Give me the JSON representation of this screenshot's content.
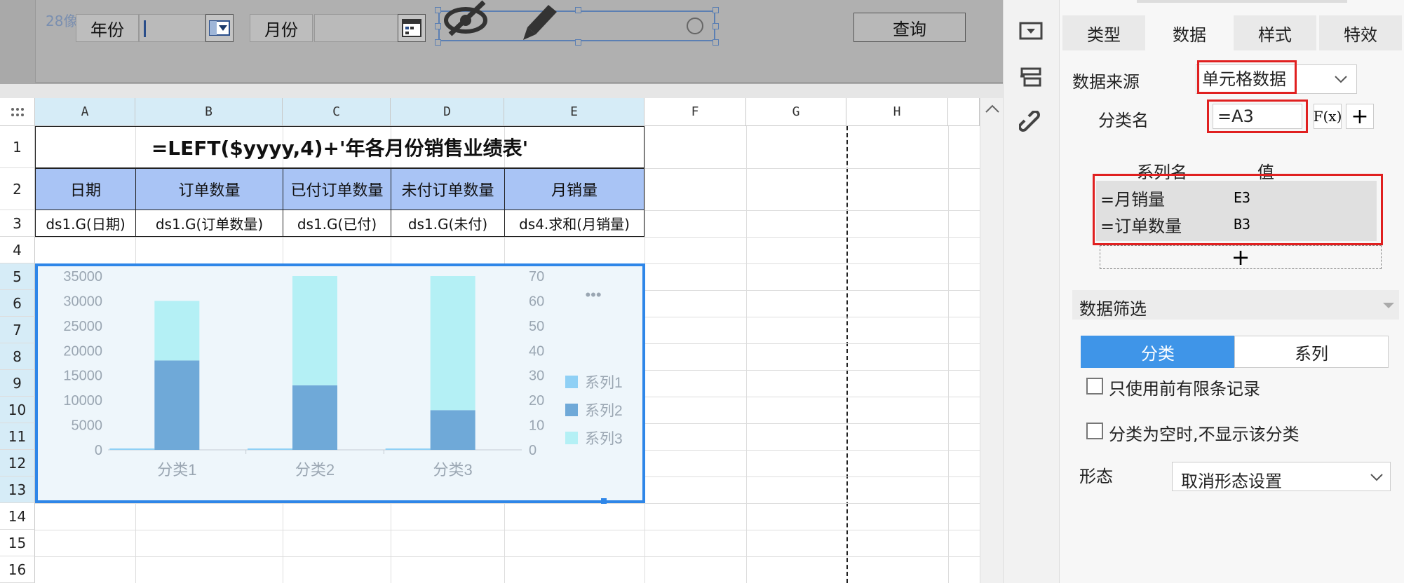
{
  "param_panel": {
    "pixel_hint": "28像素",
    "year_label": "年份",
    "month_label": "月份",
    "query_button": "查询"
  },
  "grid": {
    "columns": [
      "A",
      "B",
      "C",
      "D",
      "E",
      "F",
      "G",
      "H"
    ],
    "rows": [
      "1",
      "2",
      "3",
      "4",
      "5",
      "6",
      "7",
      "8",
      "9",
      "10",
      "11",
      "12",
      "13",
      "14",
      "15",
      "16"
    ],
    "title_formula": "=LEFT($yyyy,4)+'年各月份销售业绩表'",
    "headers": [
      "日期",
      "订单数量",
      "已付订单数量",
      "未付订单数量",
      "月销量"
    ],
    "data_row": [
      "ds1.G(日期)",
      "ds1.G(订单数量)",
      "ds1.G(已付)",
      "ds1.G(未付)",
      "ds4.求和(月销量)"
    ]
  },
  "chart_data": {
    "type": "bar",
    "stacked": true,
    "categories": [
      "分类1",
      "分类2",
      "分类3"
    ],
    "series": [
      {
        "name": "系列1",
        "axis": "left",
        "values": [
          0,
          0,
          0
        ],
        "color": "#8fd0f5"
      },
      {
        "name": "系列2",
        "axis": "left",
        "values": [
          18000,
          13000,
          8000
        ],
        "color": "#6fa9d8"
      },
      {
        "name": "系列3",
        "axis": "left",
        "values": [
          12000,
          22000,
          27000
        ],
        "color": "#b4f0f5"
      }
    ],
    "y_left_ticks": [
      "35000",
      "30000",
      "25000",
      "20000",
      "15000",
      "10000",
      "5000",
      "0"
    ],
    "y_right_ticks": [
      "70",
      "60",
      "50",
      "40",
      "30",
      "20",
      "10",
      "0"
    ],
    "ylim": [
      0,
      35000
    ],
    "y2lim": [
      0,
      70
    ],
    "legend_position": "right",
    "more_icon": "•••"
  },
  "right_panel": {
    "tabs": [
      "类型",
      "数据",
      "样式",
      "特效"
    ],
    "active_tab": "数据",
    "data_source_label": "数据来源",
    "data_source_value": "单元格数据",
    "category_label": "分类名",
    "category_value": "=A3",
    "fx_label": "F(x)",
    "series_header_name": "系列名",
    "series_header_value": "值",
    "series_rows": [
      {
        "name": "=月销量",
        "value": "E3"
      },
      {
        "name": "=订单数量",
        "value": "B3"
      }
    ],
    "add_symbol": "+",
    "filter_label": "数据筛选",
    "seg_category": "分类",
    "seg_series": "系列",
    "check_limit": "只使用前有限条记录",
    "check_hide_empty": "分类为空时,不显示该分类",
    "shape_label": "形态",
    "shape_value": "取消形态设置"
  }
}
